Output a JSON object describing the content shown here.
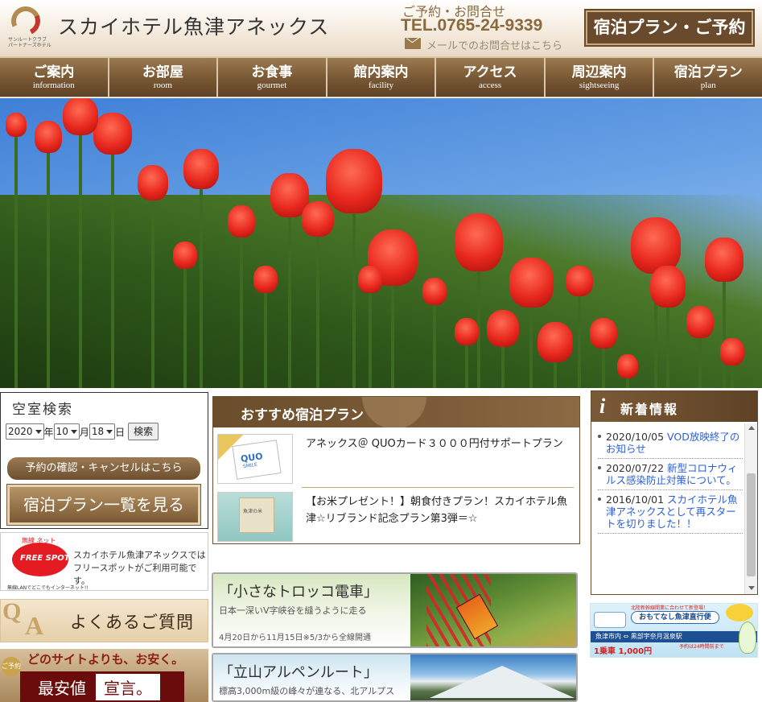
{
  "header": {
    "club_line1": "サンルートクラブ",
    "club_line2": "パートナーズホテル",
    "site_title": "スカイホテル魚津アネックス",
    "contact_label": "ご予約・お問合せ",
    "tel": "TEL.0765-24-9339",
    "mail_link": "メールでのお問合せはこちら",
    "book_button": "宿泊プラン・ご予約"
  },
  "nav": [
    {
      "jp": "ご案内",
      "en": "information"
    },
    {
      "jp": "お部屋",
      "en": "room"
    },
    {
      "jp": "お食事",
      "en": "gourmet"
    },
    {
      "jp": "館内案内",
      "en": "facility"
    },
    {
      "jp": "アクセス",
      "en": "access"
    },
    {
      "jp": "周辺案内",
      "en": "sightseeing"
    },
    {
      "jp": "宿泊プラン",
      "en": "plan"
    }
  ],
  "search": {
    "title": "空室検索",
    "year": "2020",
    "month": "10",
    "day": "18",
    "year_unit": "年",
    "month_unit": "月",
    "day_unit": "日",
    "search_button": "検索",
    "confirm_button": "予約の確認・キャンセルはこちら",
    "planlist_button": "宿泊プラン一覧を見る"
  },
  "freespot": {
    "top_text": "無線 ネット",
    "logo_text": "FREE SPOT",
    "foot_text": "無線LANでどこでもインターネット!!",
    "description": "スカイホテル魚津アネックスではフリースポットがご利用可能です。"
  },
  "faq": {
    "q": "Q",
    "a": "A",
    "label": "よくあるご質問"
  },
  "lowest": {
    "top_text": "どのサイトよりも、お安く。",
    "badge": "ご予約",
    "word1": "最安値",
    "word2": "宣言。"
  },
  "recommended": {
    "title": "おすすめ宿泊プラン",
    "plans": [
      {
        "text": "アネックス＠ QUOカード３０００円付サポートプラン"
      },
      {
        "text": "【お米プレゼント！】朝食付きプラン！スカイホテル魚津☆リブランド記念プラン第3弾＝☆"
      }
    ],
    "quo_logo": "QUO",
    "quo_sub": "SMILE",
    "rice_label": "魚津の米"
  },
  "banners": {
    "torokko": {
      "title": "「小さなトロッコ電車」",
      "sub": "日本一深いV字峡谷を縫うように走る",
      "foot": "4月20日から11月15日※5/3から全線開通"
    },
    "alpen": {
      "title": "「立山アルペンルート」",
      "sub": "標高3,000m級の峰々が連なる、北アルプス"
    }
  },
  "news": {
    "icon": "i",
    "title": "新着情報",
    "items": [
      {
        "date": "2020/10/05",
        "link": "VOD放映終了のお知らせ"
      },
      {
        "date": "2020/07/22",
        "link": "新型コロナウィルス感染防止対策について。"
      },
      {
        "date": "2016/10/01",
        "link": "スカイホテル魚津アネックスとして再スタートを切りました！！"
      }
    ]
  },
  "shuttle": {
    "top": "北陸新幹線開業に合わせて新登場！",
    "title": "おもてなし魚津直行便",
    "route": "魚津市内 ⇔ 黒部宇奈月温泉駅",
    "price": "1乗車 1,000円",
    "note": "予約は24時間前まで"
  }
}
